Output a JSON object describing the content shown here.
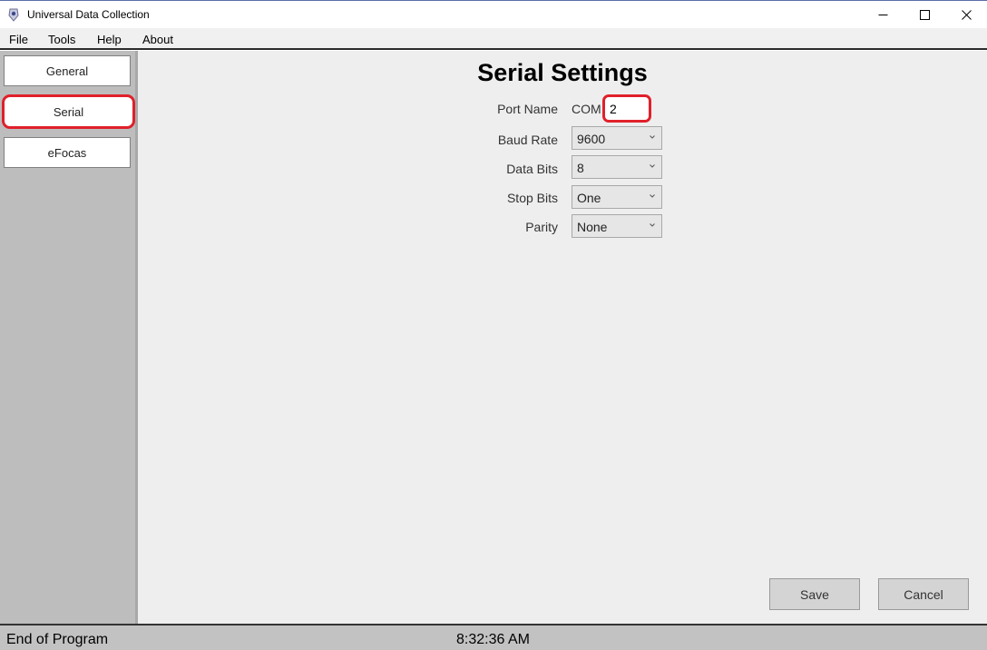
{
  "window": {
    "title": "Universal Data Collection"
  },
  "menu": {
    "items": [
      "File",
      "Tools",
      "Help",
      "About"
    ]
  },
  "sidebar": {
    "items": [
      {
        "label": "General"
      },
      {
        "label": "Serial"
      },
      {
        "label": "eFocas"
      }
    ]
  },
  "serial": {
    "title": "Serial Settings",
    "port_name_label": "Port Name",
    "com_prefix": "COM",
    "port_value": "2",
    "baud_rate_label": "Baud Rate",
    "baud_rate_value": "9600",
    "data_bits_label": "Data Bits",
    "data_bits_value": "8",
    "stop_bits_label": "Stop Bits",
    "stop_bits_value": "One",
    "parity_label": "Parity",
    "parity_value": "None"
  },
  "actions": {
    "save_label": "Save",
    "cancel_label": "Cancel"
  },
  "status": {
    "left_text": "End of Program",
    "time": "8:32:36 AM"
  },
  "colors": {
    "highlight": "#e0202a",
    "sidebar_bg": "#bdbdbd",
    "main_bg": "#eeeeee"
  },
  "icons": [
    "app-icon",
    "minimize-icon",
    "maximize-icon",
    "close-icon",
    "chevron-down-icon"
  ]
}
